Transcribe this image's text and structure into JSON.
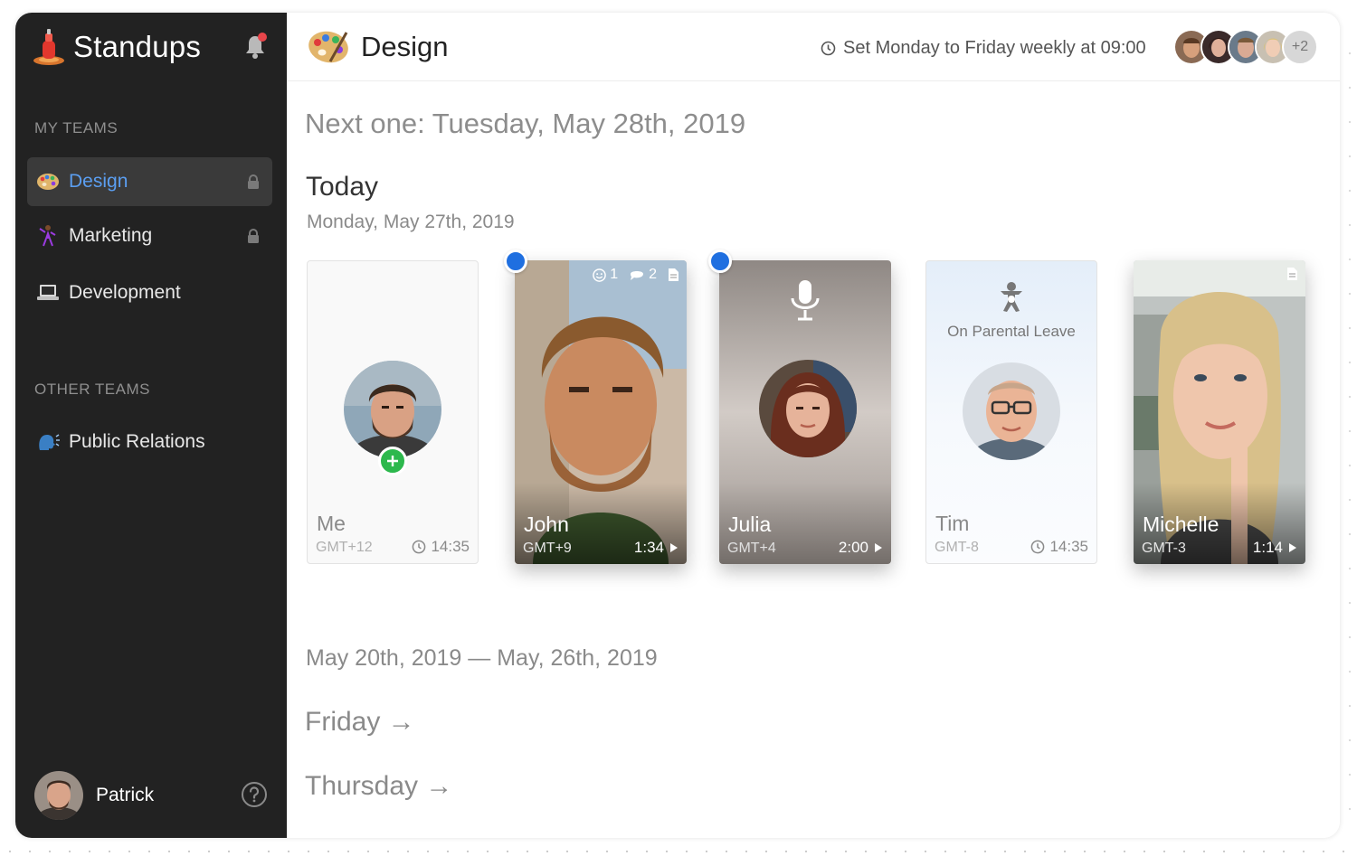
{
  "app": {
    "name": "Standups"
  },
  "sidebar": {
    "my_teams_label": "MY TEAMS",
    "my_teams": [
      {
        "label": "Design",
        "icon": "palette-icon",
        "locked": true,
        "active": true
      },
      {
        "label": "Marketing",
        "icon": "dancer-icon",
        "locked": true,
        "active": false
      },
      {
        "label": "Development",
        "icon": "laptop-icon",
        "locked": false,
        "active": false
      }
    ],
    "other_teams_label": "OTHER TEAMS",
    "other_teams": [
      {
        "label": "Public Relations",
        "icon": "speaking-head-icon"
      }
    ],
    "user": {
      "name": "Patrick"
    }
  },
  "header": {
    "title": "Design",
    "schedule": "Set Monday to Friday weekly at 09:00",
    "more_members": "+2"
  },
  "main": {
    "next_one": "Next one: Tuesday, May 28th, 2019",
    "today_heading": "Today",
    "today_date": "Monday, May 27th, 2019",
    "cards": [
      {
        "name": "Me",
        "tz": "GMT+12",
        "time": "14:35",
        "kind": "scheduled"
      },
      {
        "name": "John",
        "tz": "GMT+9",
        "duration": "1:34",
        "kind": "video",
        "reactions": "1",
        "comments": "2",
        "unseen": true
      },
      {
        "name": "Julia",
        "tz": "GMT+4",
        "duration": "2:00",
        "kind": "audio",
        "unseen": true
      },
      {
        "name": "Tim",
        "tz": "GMT-8",
        "time": "14:35",
        "kind": "leave",
        "status": "On Parental Leave"
      },
      {
        "name": "Michelle",
        "tz": "GMT-3",
        "duration": "1:14",
        "kind": "video"
      }
    ],
    "week_range": "May 20th, 2019 — May, 26th, 2019",
    "days": [
      "Friday →",
      "Thursday →"
    ]
  },
  "colors": {
    "sidebar_bg": "#222222",
    "accent": "#5b9ef0",
    "unseen_dot": "#1f6fe0",
    "add_badge": "#2db84d"
  }
}
